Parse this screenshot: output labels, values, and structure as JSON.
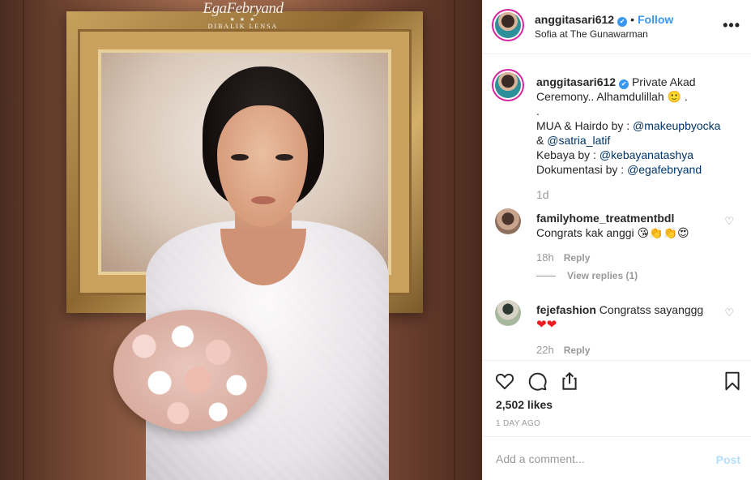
{
  "photo": {
    "watermark_main": "EgaFebryand",
    "watermark_stars": "★ ★ ★",
    "watermark_sub": "DIBALIK LENSA"
  },
  "header": {
    "username": "anggitasari612",
    "verified_icon": "verified-badge-icon",
    "separator": "•",
    "follow_label": "Follow",
    "location": "Sofia at The Gunawarman",
    "more_icon": "more-options-icon"
  },
  "caption": {
    "username": "anggitasari612",
    "text_1": "Private Akad Ceremony.. Alhamdulillah",
    "emoji_1": "🙂",
    "text_1_end": " .",
    "line_dot": ".",
    "mua_prefix": "MUA & Hairdo by : ",
    "mua_mention_1": "@makeupbyocka",
    "mua_amp": "& ",
    "mua_mention_2": "@satria_latif",
    "kebaya_prefix": "Kebaya by : ",
    "kebaya_mention": "@kebayanatashya",
    "dok_prefix": "Dokumentasi by : ",
    "dok_mention": "@egafebryand",
    "time": "1d"
  },
  "comments": [
    {
      "username": "familyhome_treatmentbdl",
      "text": "Congrats kak anggi",
      "emojis": [
        "😘",
        "👏",
        "👏",
        "😍"
      ],
      "time": "18h",
      "reply_label": "Reply",
      "view_replies": "View replies (1)"
    },
    {
      "username": "fejefashion",
      "text": "Congratss sayanggg",
      "emojis": [
        "❤",
        "❤"
      ],
      "time": "22h",
      "reply_label": "Reply"
    }
  ],
  "actions": {
    "likes": "2,502 likes",
    "ago": "1 DAY AGO"
  },
  "add_comment": {
    "placeholder": "Add a comment...",
    "post_label": "Post"
  },
  "colors": {
    "link_blue": "#3897f0",
    "mention_blue": "#003569",
    "muted_gray": "#999999",
    "post_disabled": "#b2dffc",
    "heart_red": "#ed1c24"
  }
}
